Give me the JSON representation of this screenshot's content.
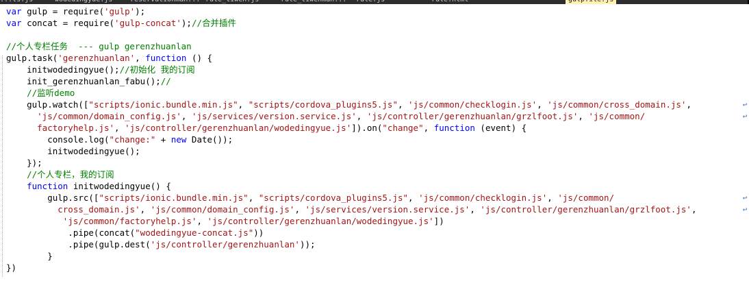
{
  "tabs": [
    {
      "label": "...ts.js"
    },
    {
      "label": "wodedingyue.js"
    },
    {
      "label": "reservationman..."
    },
    {
      "label": "rule_tiwen.js"
    },
    {
      "label": "rule_tiwenman..."
    },
    {
      "label": "rule.js"
    },
    {
      "label": "rule.html"
    },
    {
      "label": "gulpfile.js",
      "active": true
    }
  ],
  "code": [
    [
      [
        "kw",
        "var"
      ],
      [
        "t",
        " gulp = require("
      ],
      [
        "str",
        "'gulp'"
      ],
      [
        "t",
        ");"
      ]
    ],
    [
      [
        "kw",
        "var"
      ],
      [
        "t",
        " concat = require("
      ],
      [
        "str",
        "'gulp-concat'"
      ],
      [
        "t",
        ");"
      ],
      [
        "com",
        "//合并插件"
      ]
    ],
    [],
    [
      [
        "com",
        "//个人专栏任务  --- gulp gerenzhuanlan"
      ]
    ],
    [
      [
        "t",
        "gulp.task("
      ],
      [
        "str",
        "'gerenzhuanlan'"
      ],
      [
        "t",
        ", "
      ],
      [
        "kw",
        "function"
      ],
      [
        "t",
        " () {"
      ]
    ],
    [
      [
        "t",
        "    initwodedingyue();"
      ],
      [
        "com",
        "//初始化 我的订阅"
      ]
    ],
    [
      [
        "t",
        "    init_gerenzhuanlan_fabu();"
      ],
      [
        "com",
        "//"
      ]
    ],
    [
      [
        "com",
        "    //监听demo"
      ]
    ],
    [
      [
        "t",
        "    gulp.watch(["
      ],
      [
        "str",
        "\"scripts/ionic.bundle.min.js\""
      ],
      [
        "t",
        ", "
      ],
      [
        "str",
        "\"scripts/cordova_plugins5.js\""
      ],
      [
        "t",
        ", "
      ],
      [
        "str",
        "'js/common/checklogin.js'"
      ],
      [
        "t",
        ", "
      ],
      [
        "str",
        "'js/common/cross_domain.js'"
      ],
      [
        "t",
        ", "
      ]
    ],
    [
      [
        "t",
        "      "
      ],
      [
        "str",
        "'js/common/domain_config.js'"
      ],
      [
        "t",
        ", "
      ],
      [
        "str",
        "'js/services/version.service.js'"
      ],
      [
        "t",
        ", "
      ],
      [
        "str",
        "'js/controller/gerenzhuanlan/grzlfoot.js'"
      ],
      [
        "t",
        ", "
      ],
      [
        "str",
        "'js/common/"
      ]
    ],
    [
      [
        "str",
        "      factoryhelp.js'"
      ],
      [
        "t",
        ", "
      ],
      [
        "str",
        "'js/controller/gerenzhuanlan/wodedingyue.js'"
      ],
      [
        "t",
        "]).on("
      ],
      [
        "str",
        "\"change\""
      ],
      [
        "t",
        ", "
      ],
      [
        "kw",
        "function"
      ],
      [
        "t",
        " (event) {"
      ]
    ],
    [
      [
        "t",
        "        console.log("
      ],
      [
        "str",
        "\"change:\""
      ],
      [
        "t",
        " + "
      ],
      [
        "kw",
        "new"
      ],
      [
        "t",
        " Date());"
      ]
    ],
    [
      [
        "t",
        "        initwodedingyue();"
      ]
    ],
    [
      [
        "t",
        "    });"
      ]
    ],
    [
      [
        "com",
        "    //个人专栏，我的订阅"
      ]
    ],
    [
      [
        "t",
        "    "
      ],
      [
        "kw",
        "function"
      ],
      [
        "t",
        " initwodedingyue() {"
      ]
    ],
    [
      [
        "t",
        "        gulp.src(["
      ],
      [
        "str",
        "\"scripts/ionic.bundle.min.js\""
      ],
      [
        "t",
        ", "
      ],
      [
        "str",
        "\"scripts/cordova_plugins5.js\""
      ],
      [
        "t",
        ", "
      ],
      [
        "str",
        "'js/common/checklogin.js'"
      ],
      [
        "t",
        ", "
      ],
      [
        "str",
        "'js/common/"
      ]
    ],
    [
      [
        "str",
        "          cross_domain.js'"
      ],
      [
        "t",
        ", "
      ],
      [
        "str",
        "'js/common/domain_config.js'"
      ],
      [
        "t",
        ", "
      ],
      [
        "str",
        "'js/services/version.service.js'"
      ],
      [
        "t",
        ", "
      ],
      [
        "str",
        "'js/controller/gerenzhuanlan/grzlfoot.js'"
      ],
      [
        "t",
        ","
      ]
    ],
    [
      [
        "t",
        "           "
      ],
      [
        "str",
        "'js/common/factoryhelp.js'"
      ],
      [
        "t",
        ", "
      ],
      [
        "str",
        "'js/controller/gerenzhuanlan/wodedingyue.js'"
      ],
      [
        "t",
        "])"
      ]
    ],
    [
      [
        "t",
        "            .pipe(concat("
      ],
      [
        "str",
        "\"wodedingyue-concat.js\""
      ],
      [
        "t",
        "))"
      ]
    ],
    [
      [
        "t",
        "            .pipe(gulp.dest("
      ],
      [
        "str",
        "'js/controller/gerenzhuanlan'"
      ],
      [
        "t",
        "));"
      ]
    ],
    [
      [
        "t",
        "        }"
      ]
    ],
    [
      [
        "t",
        "})"
      ]
    ]
  ],
  "wrap_glyph": "↩",
  "wrapped_lines": [
    8,
    9,
    16,
    17
  ]
}
